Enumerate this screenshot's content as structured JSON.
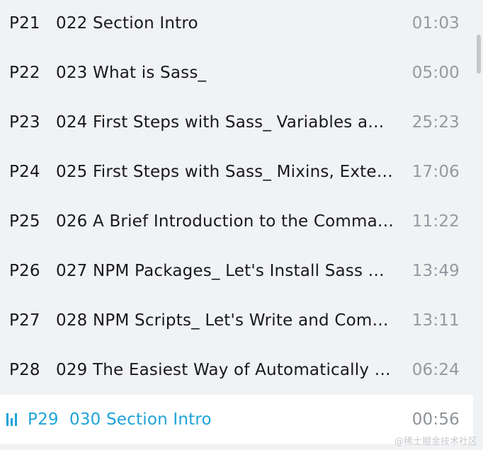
{
  "playlist": {
    "items": [
      {
        "part": "P21",
        "title": "022 Section Intro",
        "duration": "01:03",
        "active": false
      },
      {
        "part": "P22",
        "title": "023 What is Sass_",
        "duration": "05:00",
        "active": false
      },
      {
        "part": "P23",
        "title": "024 First Steps with Sass_ Variables a…",
        "duration": "25:23",
        "active": false
      },
      {
        "part": "P24",
        "title": "025 First Steps with Sass_ Mixins, Exte…",
        "duration": "17:06",
        "active": false
      },
      {
        "part": "P25",
        "title": "026 A Brief Introduction to the Comma…",
        "duration": "11:22",
        "active": false
      },
      {
        "part": "P26",
        "title": "027 NPM Packages_ Let's Install Sass …",
        "duration": "13:49",
        "active": false
      },
      {
        "part": "P27",
        "title": "028 NPM Scripts_ Let's Write and Com…",
        "duration": "13:11",
        "active": false
      },
      {
        "part": "P28",
        "title": "029 The Easiest Way of Automatically …",
        "duration": "06:24",
        "active": false
      },
      {
        "part": "P29",
        "title": "030 Section Intro",
        "duration": "00:56",
        "active": true
      }
    ]
  },
  "icons": {
    "playing": "now-playing-bars-icon"
  },
  "colors": {
    "accent": "#1ea3d8",
    "background": "#f1f2f4",
    "active_row": "#ffffff",
    "duration": "#9499a0"
  },
  "watermark": "@稀土掘金技术社区"
}
